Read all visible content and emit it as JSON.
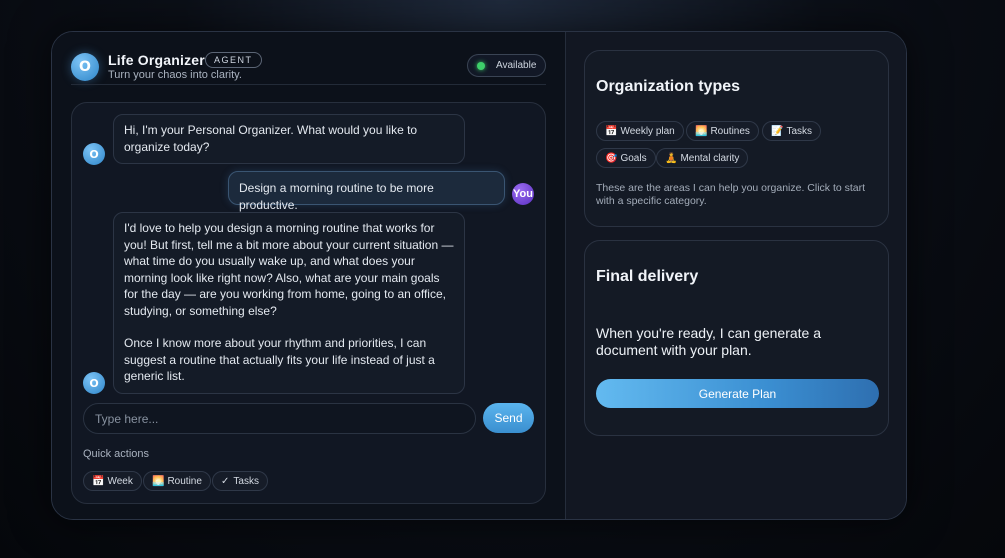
{
  "header": {
    "avatar_letter": "O",
    "title": "Life Organizer",
    "badge": "AGENT",
    "subtitle": "Turn your chaos into clarity.",
    "status": "Available"
  },
  "chat": {
    "messages": [
      {
        "role": "agent",
        "avatar": "O",
        "text": "Hi, I'm your Personal Organizer. What would you like to organize today?"
      },
      {
        "role": "user",
        "avatar": "You",
        "text": "Design a morning routine to be more productive."
      },
      {
        "role": "agent",
        "avatar": "O",
        "text_p1": "I'd love to help you design a morning routine that works for you! But first, tell me a bit more about your current situation — what time do you usually wake up, and what does your morning look like right now? Also, what are your main goals for the day — are you working from home, going to an office, studying, or something else?",
        "text_p2": "Once I know more about your rhythm and priorities, I can suggest a routine that actually fits your life instead of just a generic list."
      }
    ],
    "input_placeholder": "Type here...",
    "send_label": "Send",
    "quick_actions_label": "Quick actions",
    "quick_actions": [
      {
        "icon": "📅",
        "label": "Week"
      },
      {
        "icon": "🌅",
        "label": "Routine"
      },
      {
        "icon": "✓",
        "label": "Tasks"
      }
    ]
  },
  "organization": {
    "title": "Organization types",
    "types": [
      {
        "icon": "📅",
        "label": "Weekly plan"
      },
      {
        "icon": "🌅",
        "label": "Routines"
      },
      {
        "icon": "📝",
        "label": "Tasks"
      },
      {
        "icon": "🎯",
        "label": "Goals"
      },
      {
        "icon": "🧘",
        "label": "Mental clarity"
      }
    ],
    "description": "These are the areas I can help you organize. Click to start with a specific category."
  },
  "delivery": {
    "title": "Final delivery",
    "text": "When you're ready, I can generate a document with your plan.",
    "button_label": "Generate Plan"
  }
}
